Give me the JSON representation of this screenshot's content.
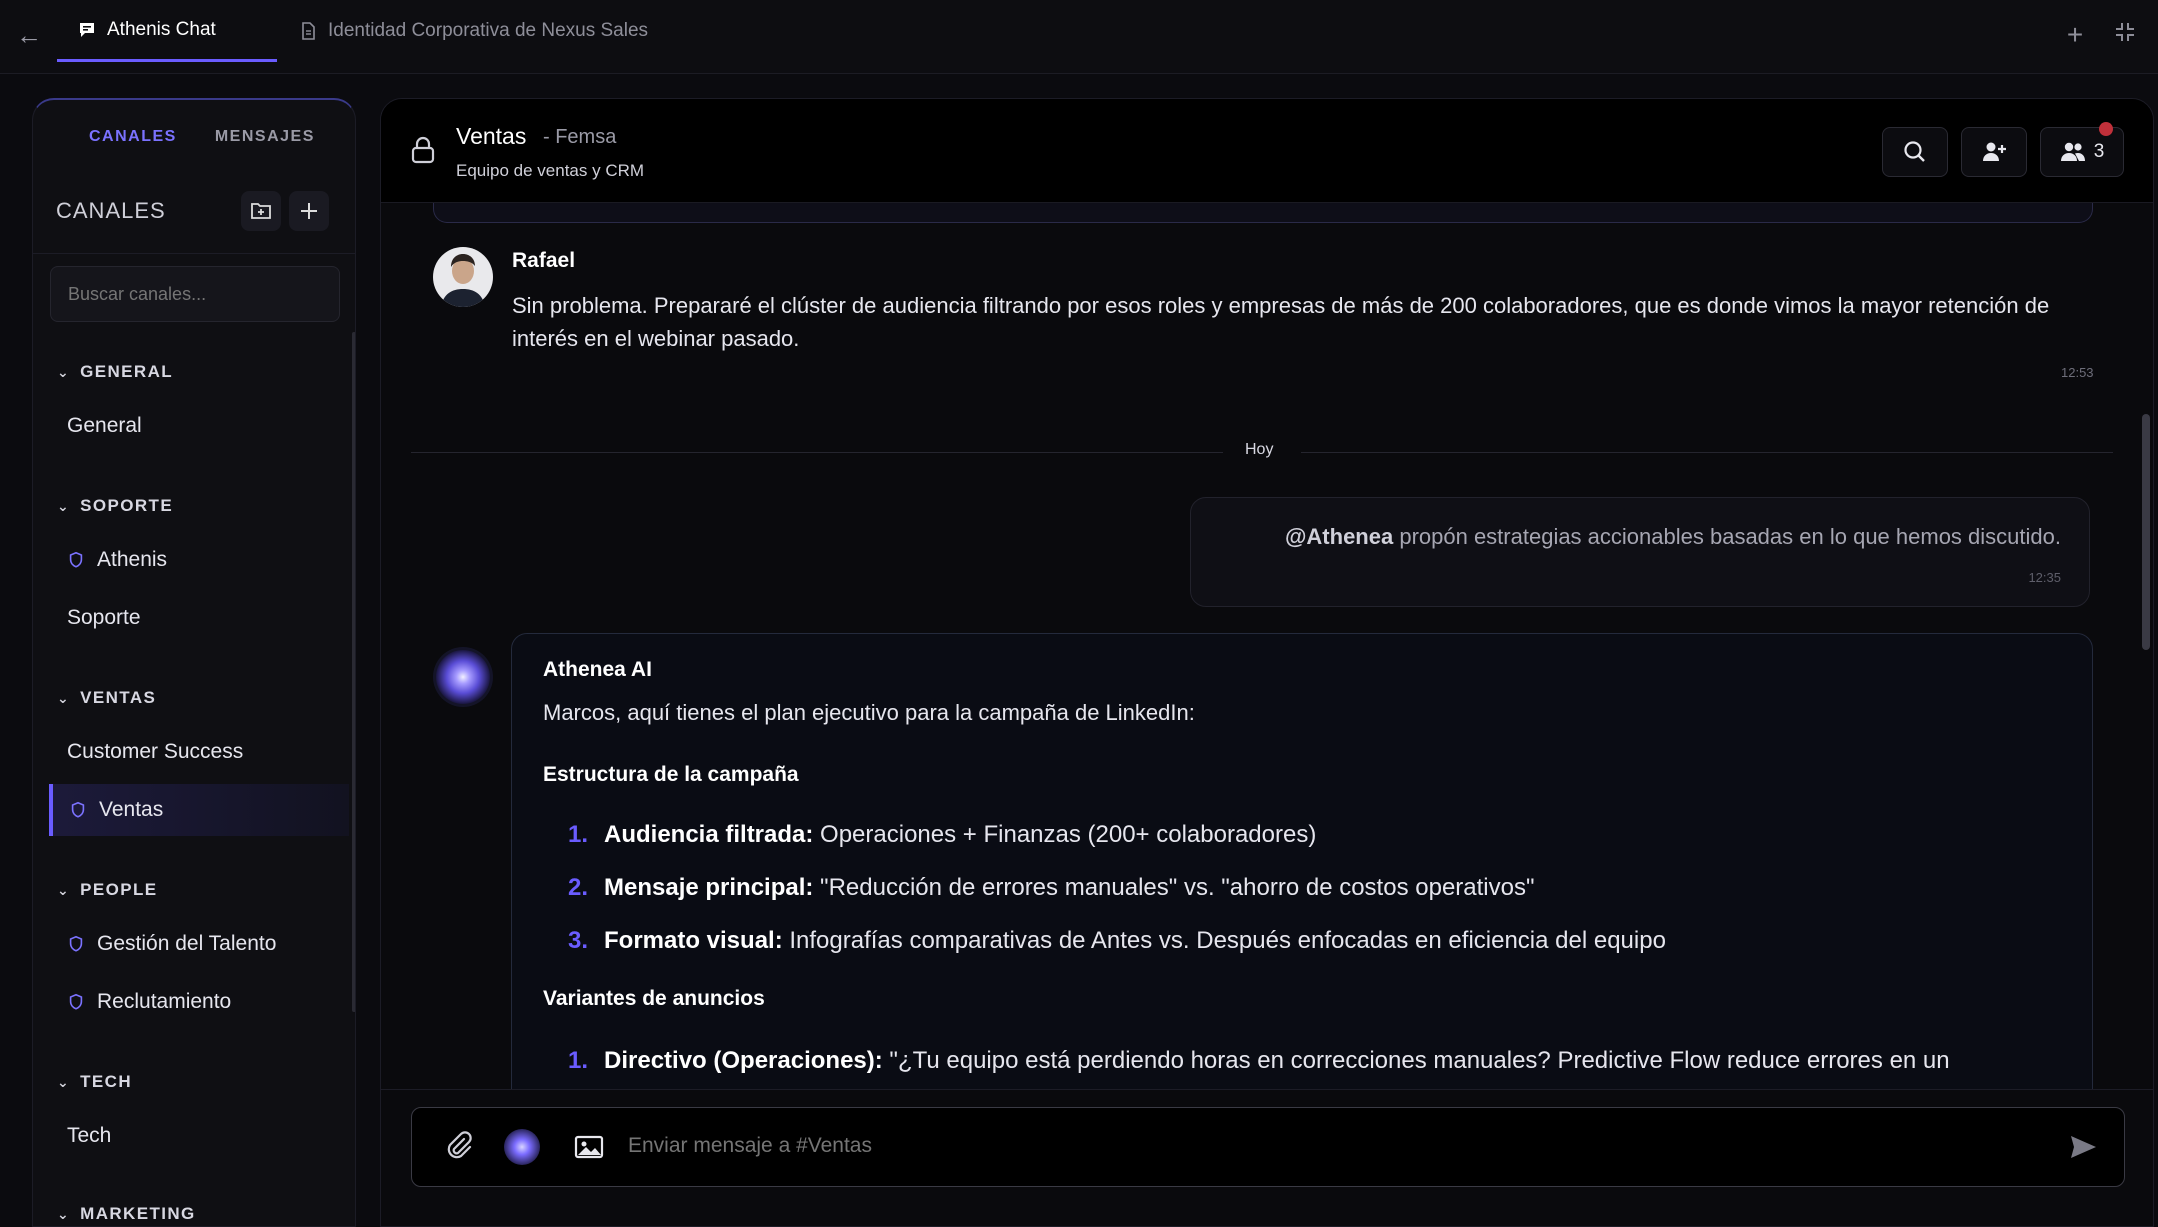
{
  "tabs": [
    {
      "label": "Athenis Chat",
      "active": true
    },
    {
      "label": "Identidad Corporativa de Nexus Sales",
      "active": false
    }
  ],
  "sidebar": {
    "tab_channels": "CANALES",
    "tab_messages": "MENSAJES",
    "heading": "CANALES",
    "search_placeholder": "Buscar canales...",
    "groups": [
      {
        "name": "GENERAL",
        "items": [
          {
            "label": "General",
            "private": false
          }
        ]
      },
      {
        "name": "SOPORTE",
        "items": [
          {
            "label": "Athenis",
            "private": true
          },
          {
            "label": "Soporte",
            "private": false
          }
        ]
      },
      {
        "name": "VENTAS",
        "items": [
          {
            "label": "Customer Success",
            "private": false
          },
          {
            "label": "Ventas",
            "private": true,
            "selected": true
          }
        ]
      },
      {
        "name": "PEOPLE",
        "items": [
          {
            "label": "Gestión del Talento",
            "private": true
          },
          {
            "label": "Reclutamiento",
            "private": true
          }
        ]
      },
      {
        "name": "TECH",
        "items": [
          {
            "label": "Tech",
            "private": false
          }
        ]
      },
      {
        "name": "MARKETING",
        "items": []
      }
    ]
  },
  "channel": {
    "name": "Ventas",
    "org": "- Femsa",
    "description": "Equipo de ventas y CRM",
    "member_count": "3"
  },
  "messages": {
    "rafael": {
      "author": "Rafael",
      "text": "Sin problema. Prepararé el clúster de audiencia filtrando por esos roles y empresas de más de 200 colaboradores, que es donde vimos la mayor retención de interés en el webinar pasado.",
      "time": "12:53"
    },
    "divider": "Hoy",
    "mine": {
      "mention": "@Athenea",
      "text": " propón estrategias accionables basadas en lo que hemos discutido.",
      "time": "12:35"
    },
    "ai": {
      "author": "Athenea AI",
      "intro": "Marcos, aquí tienes el plan ejecutivo para la campaña de LinkedIn:",
      "section1": "Estructura de la campaña",
      "list1": [
        {
          "n": "1.",
          "label": "Audiencia filtrada:",
          "text": " Operaciones + Finanzas (200+ colaboradores)"
        },
        {
          "n": "2.",
          "label": "Mensaje principal:",
          "text": " \"Reducción de errores manuales\" vs. \"ahorro de costos operativos\""
        },
        {
          "n": "3.",
          "label": "Formato visual:",
          "text": " Infografías comparativas de Antes vs. Después enfocadas en eficiencia del equipo"
        }
      ],
      "section2": "Variantes de anuncios",
      "list2": [
        {
          "n": "1.",
          "label": "Directivo (Operaciones):",
          "text": " \"¿Tu equipo está perdiendo horas en correcciones manuales? Predictive Flow reduce errores en un"
        }
      ]
    }
  },
  "composer": {
    "placeholder": "Enviar mensaje a #Ventas"
  }
}
